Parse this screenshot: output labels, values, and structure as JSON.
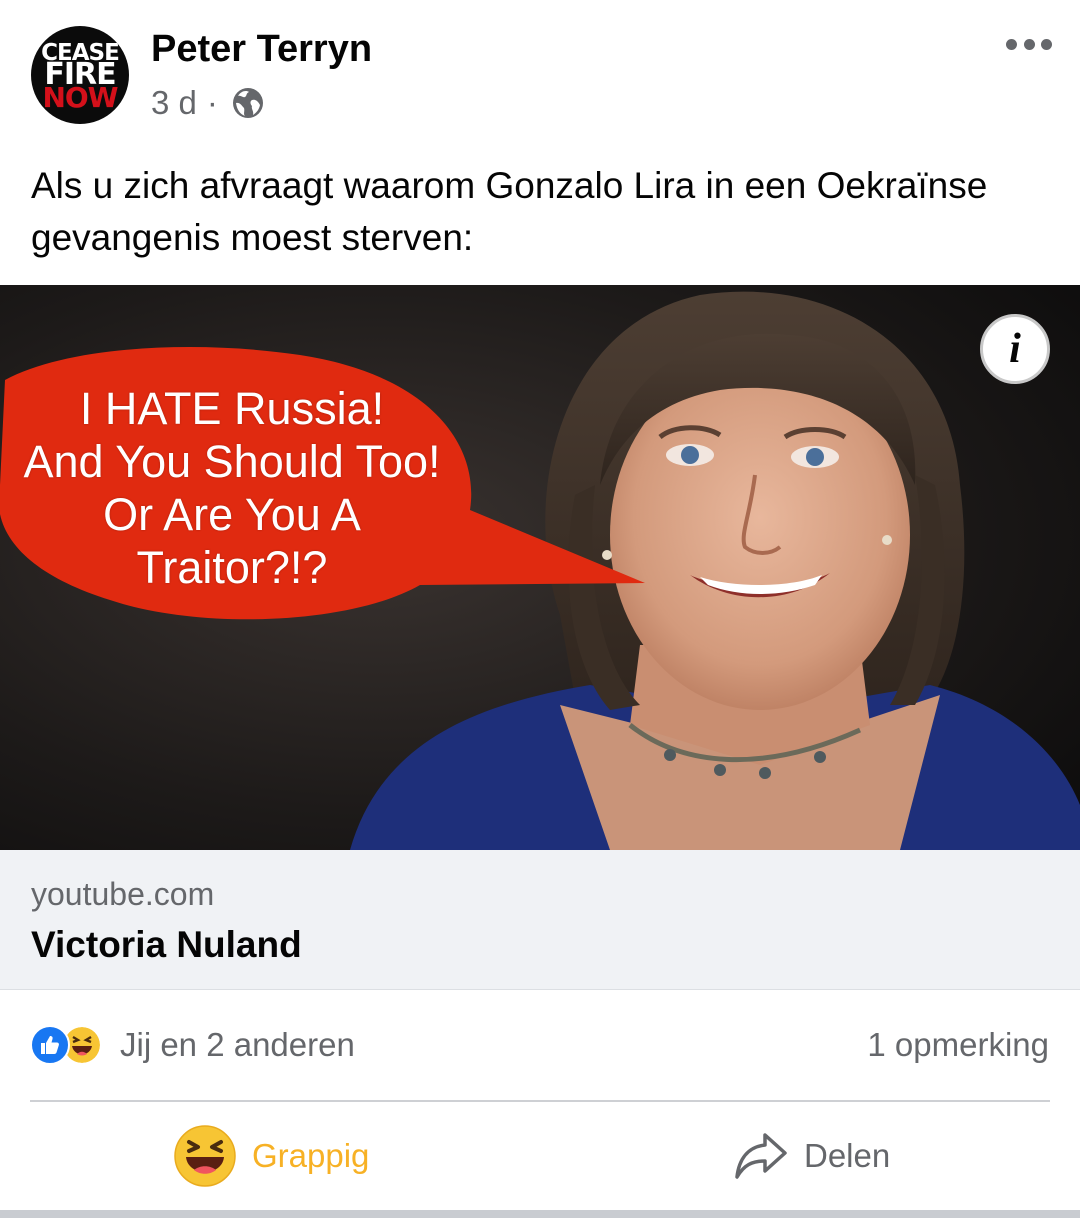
{
  "post": {
    "author": "Peter Terryn",
    "avatar": {
      "line1": "CEASE",
      "line2": "FIRE",
      "line3": "NOW"
    },
    "time": "3 d",
    "separator": "·",
    "privacy_icon": "globe-icon",
    "more_icon": "more-options-icon",
    "text": "Als u zich afvraagt waarom Gonzalo Lira in een Oekraïnse gevangenis moest sterven:"
  },
  "media": {
    "bubble_lines": [
      "I HATE Russia!",
      "And You Should Too!",
      "Or Are You A",
      "Traitor?!?"
    ],
    "info_label": "i",
    "colors": {
      "bubble": "#e02a10",
      "background": "#141414",
      "jacket": "#1e2f7a"
    }
  },
  "link": {
    "domain": "youtube.com",
    "title": "Victoria Nuland"
  },
  "reactions": {
    "icons": [
      "like-icon",
      "haha-icon"
    ],
    "summary": "Jij en 2 anderen",
    "comments": "1 opmerking"
  },
  "actions": {
    "reaction_label": "Grappig",
    "reaction_color": "#f7b125",
    "share_label": "Delen"
  }
}
